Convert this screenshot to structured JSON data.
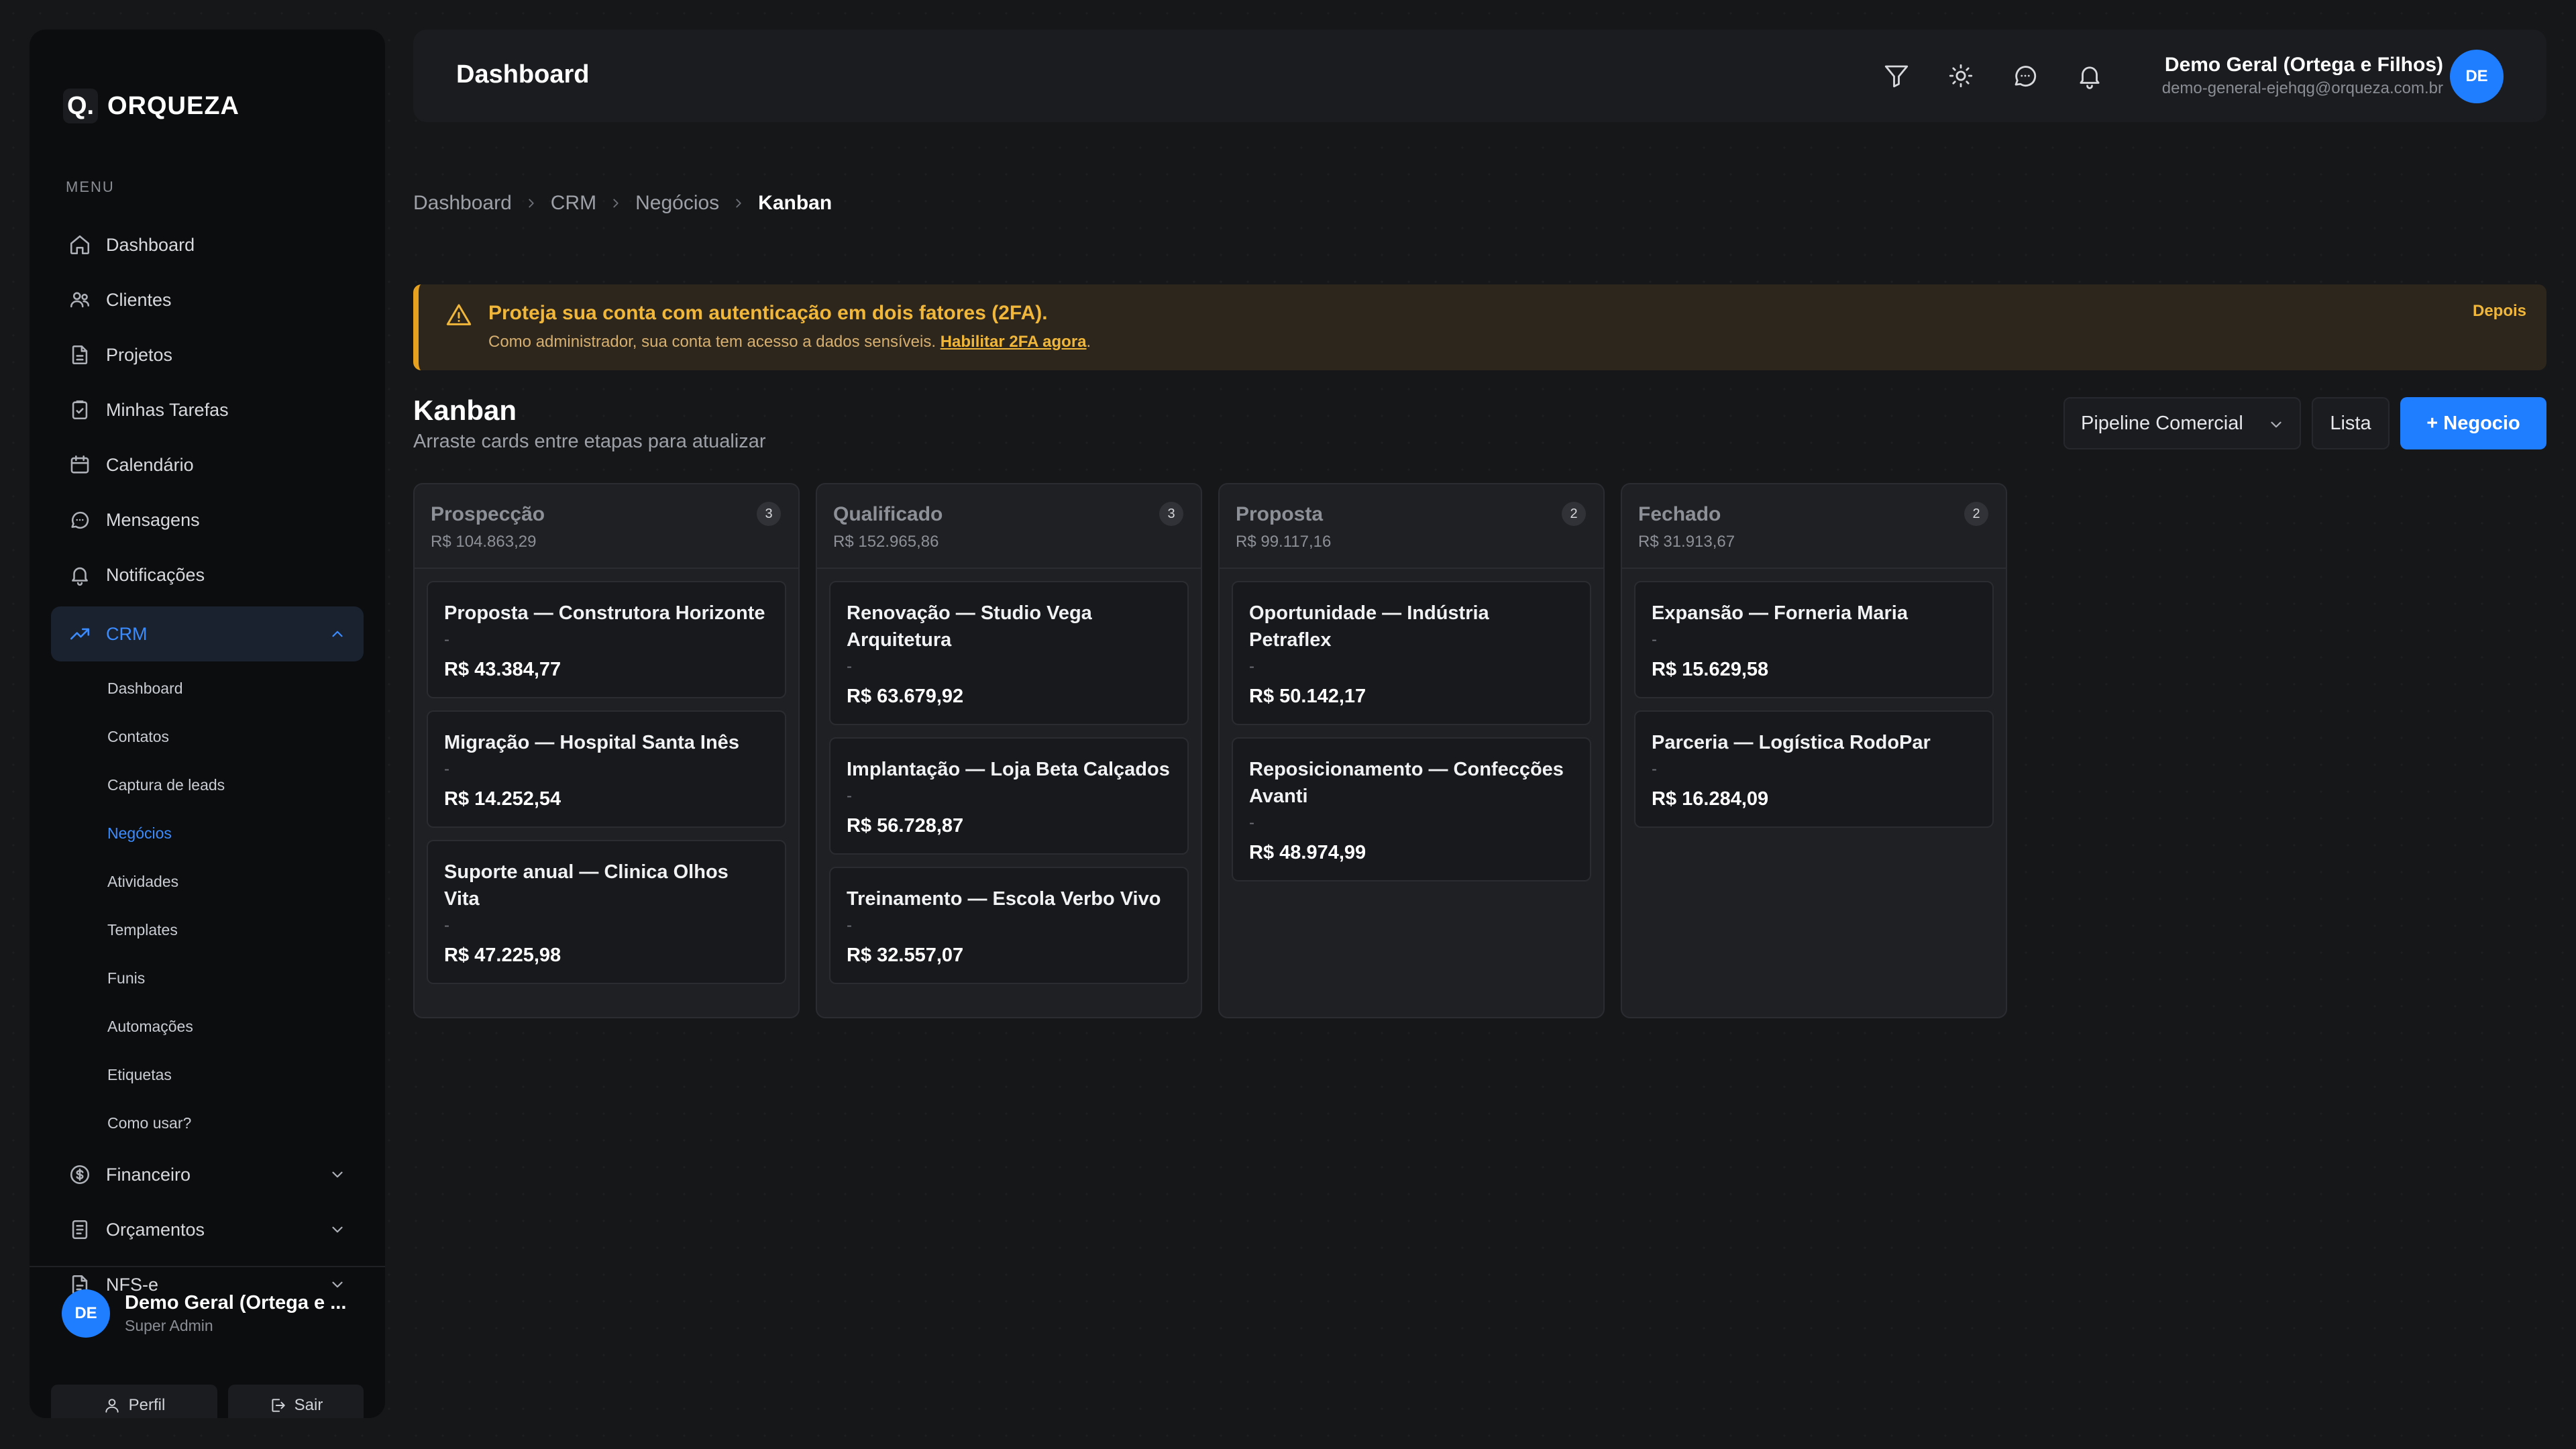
{
  "brand": {
    "mark": "Q.",
    "name": "ORQUEZA"
  },
  "sidebar": {
    "menu_label": "MENU",
    "items": [
      {
        "label": "Dashboard",
        "icon": "home-icon"
      },
      {
        "label": "Clientes",
        "icon": "users-icon"
      },
      {
        "label": "Projetos",
        "icon": "file-icon"
      },
      {
        "label": "Minhas Tarefas",
        "icon": "clipboard-check-icon"
      },
      {
        "label": "Calendário",
        "icon": "calendar-icon"
      },
      {
        "label": "Mensagens",
        "icon": "message-icon"
      },
      {
        "label": "Notificações",
        "icon": "bell-icon"
      }
    ],
    "crm": {
      "label": "CRM",
      "icon": "trending-up-icon",
      "sub": [
        "Dashboard",
        "Contatos",
        "Captura de leads",
        "Negócios",
        "Atividades",
        "Templates",
        "Funis",
        "Automações",
        "Etiquetas",
        "Como usar?"
      ],
      "active_sub": "Negócios"
    },
    "bottom_items": [
      {
        "label": "Financeiro",
        "icon": "dollar-icon"
      },
      {
        "label": "Orçamentos",
        "icon": "receipt-icon"
      },
      {
        "label": "NFS-e",
        "icon": "document-icon"
      }
    ],
    "user": {
      "initials": "DE",
      "name": "Demo Geral (Ortega e ...",
      "role": "Super Admin"
    },
    "profile_btn": "Perfil",
    "logout_btn": "Sair"
  },
  "header": {
    "title": "Dashboard",
    "user_name": "Demo Geral (Ortega e Filhos)",
    "user_email": "demo-general-ejehqg@orqueza.com.br",
    "initials": "DE"
  },
  "breadcrumb": [
    "Dashboard",
    "CRM",
    "Negócios",
    "Kanban"
  ],
  "alert": {
    "title": "Proteja sua conta com autenticação em dois fatores (2FA).",
    "desc": "Como administrador, sua conta tem acesso a dados sensíveis.",
    "link": "Habilitar 2FA agora",
    "period": ".",
    "dismiss": "Depois"
  },
  "page": {
    "title": "Kanban",
    "subtitle": "Arraste cards entre etapas para atualizar",
    "pipeline": "Pipeline Comercial",
    "list_btn": "Lista",
    "new_btn": "+ Negocio"
  },
  "columns": [
    {
      "name": "Prospecção",
      "total": "R$ 104.863,29",
      "count": "3",
      "cards": [
        {
          "title": "Proposta — Construtora Horizonte",
          "sub": "-",
          "value": "R$ 43.384,77"
        },
        {
          "title": "Migração — Hospital Santa Inês",
          "sub": "-",
          "value": "R$ 14.252,54"
        },
        {
          "title": "Suporte anual — Clinica Olhos Vita",
          "sub": "-",
          "value": "R$ 47.225,98"
        }
      ]
    },
    {
      "name": "Qualificado",
      "total": "R$ 152.965,86",
      "count": "3",
      "cards": [
        {
          "title": "Renovação — Studio Vega Arquitetura",
          "sub": "-",
          "value": "R$ 63.679,92"
        },
        {
          "title": "Implantação — Loja Beta Calçados",
          "sub": "-",
          "value": "R$ 56.728,87"
        },
        {
          "title": "Treinamento — Escola Verbo Vivo",
          "sub": "-",
          "value": "R$ 32.557,07"
        }
      ]
    },
    {
      "name": "Proposta",
      "total": "R$ 99.117,16",
      "count": "2",
      "cards": [
        {
          "title": "Oportunidade — Indústria Petraflex",
          "sub": "-",
          "value": "R$ 50.142,17"
        },
        {
          "title": "Reposicionamento — Confecções Avanti",
          "sub": "-",
          "value": "R$ 48.974,99"
        }
      ]
    },
    {
      "name": "Fechado",
      "total": "R$ 31.913,67",
      "count": "2",
      "cards": [
        {
          "title": "Expansão — Forneria Maria",
          "sub": "-",
          "value": "R$ 15.629,58"
        },
        {
          "title": "Parceria — Logística RodoPar",
          "sub": "-",
          "value": "R$ 16.284,09"
        }
      ]
    }
  ],
  "colors": {
    "accent": "#1f7dff",
    "warning": "#f1b73a",
    "background": "#161719"
  }
}
